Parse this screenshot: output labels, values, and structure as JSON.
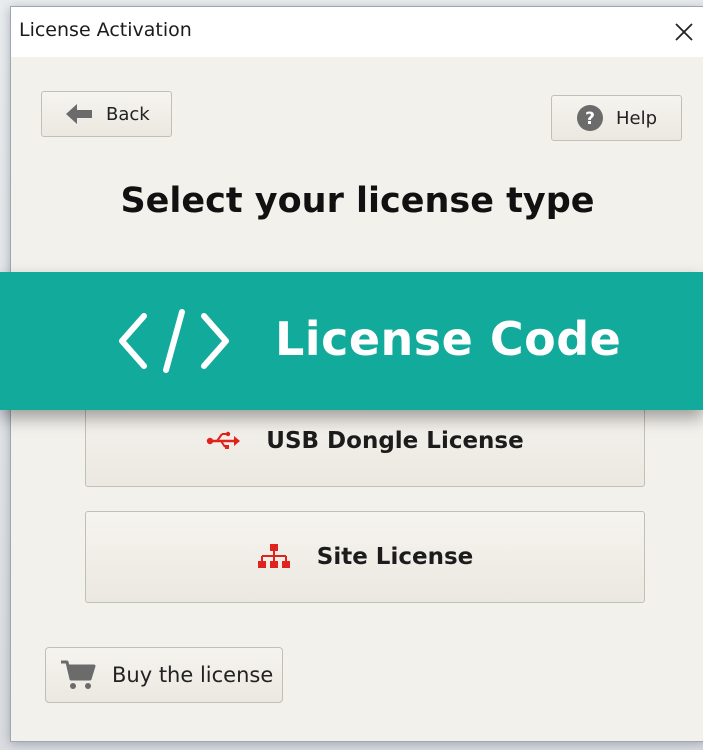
{
  "window": {
    "title": "License Activation"
  },
  "toolbar": {
    "back_label": "Back",
    "back_icon": "arrow-left-icon",
    "help_label": "Help",
    "help_icon": "question-circle-icon"
  },
  "main": {
    "heading": "Select your license type",
    "options": [
      {
        "label": "License Code",
        "icon": "code-brackets-icon",
        "color": "#12aa9b"
      },
      {
        "label": "USB Dongle License",
        "icon": "usb-icon",
        "color": "#e0231c"
      },
      {
        "label": "Site License",
        "icon": "sitemap-icon",
        "color": "#e0231c"
      }
    ],
    "buy_label": "Buy the license",
    "buy_icon": "shopping-cart-icon"
  },
  "colors": {
    "accent": "#12aa9b",
    "icon_red": "#e0231c",
    "icon_gray": "#666666"
  }
}
